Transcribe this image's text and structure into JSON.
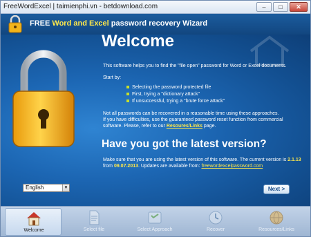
{
  "window": {
    "title": "FreeWordExcel | taimienphi.vn - betdownload.com"
  },
  "header": {
    "title_prefix": "FREE ",
    "title_highlight": "Word and Excel",
    "title_suffix": " password recovery Wizard"
  },
  "main": {
    "heading": "Welcome",
    "intro": "This software helps you to find the \"file open\" password for Word or Excel documents.",
    "start_by": "Start by:",
    "steps": [
      "Selecting the password protected file",
      "First, trying a \"dictionary attack\"",
      "If unsuccessful, trying a \"brute force attack\""
    ],
    "note_line1": "Not all passwords can be recovered in a reasonable time using these approaches.",
    "note_line2": "If you have difficulties, use the guaranteed password reset function from commercial",
    "note_line3_prefix": "software. Please, refer to our ",
    "note_line3_link": "Resoures/Links",
    "note_line3_suffix": " page.",
    "latest_heading": "Have you got the latest version?",
    "version_line1_prefix": "Make sure that you are using the latest version of this software. The current version is ",
    "version_number": "2.1.13",
    "version_line2_prefix": "from ",
    "version_date": "09.07.2013",
    "version_line2_mid": ". Updates are available from: ",
    "update_link": "freewordexcelpassword.com"
  },
  "language": {
    "selected": "English"
  },
  "next_button": {
    "label": "Next",
    "arrow": ">"
  },
  "nav": [
    {
      "label": "Welcome",
      "icon": "house-icon"
    },
    {
      "label": "Select file",
      "icon": "file-icon"
    },
    {
      "label": "Select Approach",
      "icon": "approach-icon"
    },
    {
      "label": "Recover",
      "icon": "recover-icon"
    },
    {
      "label": "Resources/Links",
      "icon": "links-icon"
    }
  ],
  "colors": {
    "accent_yellow": "#ffe84a",
    "body_blue": "#1c66b3",
    "nav_bg": "#b3c6de"
  }
}
